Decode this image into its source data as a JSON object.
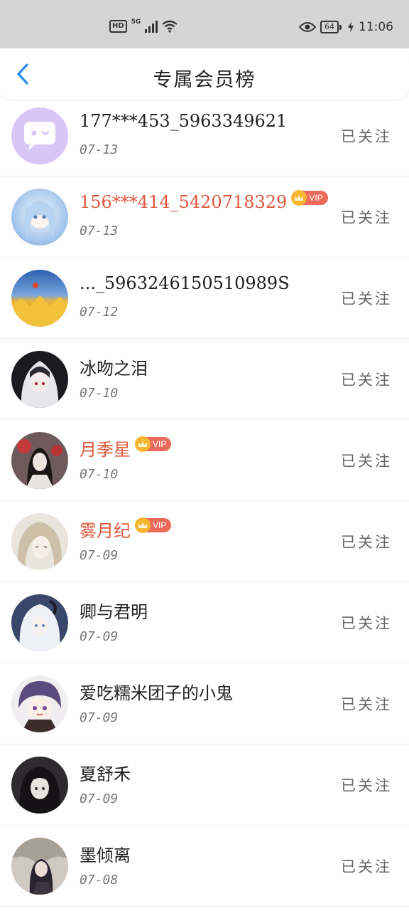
{
  "status_bar": {
    "hd": "HD",
    "network": "5G",
    "battery": "64",
    "time": "11:06"
  },
  "header": {
    "title": "专属会员榜",
    "back_icon": "chevron-left-icon"
  },
  "colors": {
    "accent": "#2c8ef0",
    "vip_name": "#e0583f",
    "vip_badge": "#ec6a5a",
    "crown": "#f6b630"
  },
  "members": [
    {
      "name": "177***453_5963349621",
      "date": "07-13",
      "vip": false,
      "vip_label": "",
      "follow": "已关注"
    },
    {
      "name": "156***414_5420718329",
      "date": "07-13",
      "vip": true,
      "vip_label": "VIP",
      "follow": "已关注"
    },
    {
      "name": "..._5963246150510989S",
      "date": "07-12",
      "vip": false,
      "vip_label": "",
      "follow": "已关注"
    },
    {
      "name": "冰吻之泪",
      "date": "07-10",
      "vip": false,
      "vip_label": "",
      "follow": "已关注"
    },
    {
      "name": "月季星",
      "date": "07-10",
      "vip": true,
      "vip_label": "VIP",
      "follow": "已关注"
    },
    {
      "name": "雾月纪",
      "date": "07-09",
      "vip": true,
      "vip_label": "VIP",
      "follow": "已关注"
    },
    {
      "name": "卿与君明",
      "date": "07-09",
      "vip": false,
      "vip_label": "",
      "follow": "已关注"
    },
    {
      "name": "爱吃糯米团子的小鬼",
      "date": "07-09",
      "vip": false,
      "vip_label": "",
      "follow": "已关注"
    },
    {
      "name": "夏舒禾",
      "date": "07-09",
      "vip": false,
      "vip_label": "",
      "follow": "已关注"
    },
    {
      "name": "墨倾离",
      "date": "07-08",
      "vip": false,
      "vip_label": "",
      "follow": "已关注"
    }
  ]
}
